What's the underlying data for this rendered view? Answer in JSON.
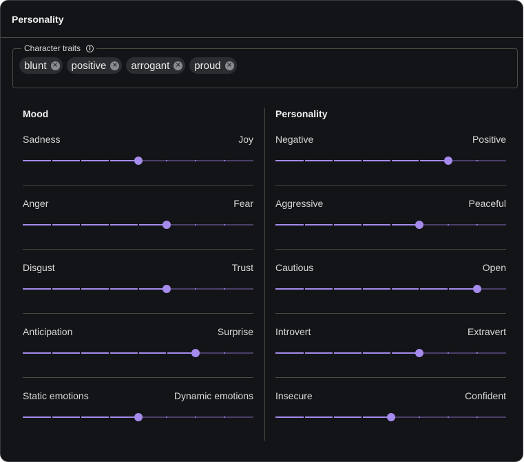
{
  "header": {
    "title": "Personality"
  },
  "traits": {
    "legend": "Character traits",
    "chips": [
      "blunt",
      "positive",
      "arrogant",
      "proud"
    ]
  },
  "mood": {
    "title": "Mood",
    "sliders": [
      {
        "left": "Sadness",
        "right": "Joy",
        "value": 0.5
      },
      {
        "left": "Anger",
        "right": "Fear",
        "value": 0.625
      },
      {
        "left": "Disgust",
        "right": "Trust",
        "value": 0.625
      },
      {
        "left": "Anticipation",
        "right": "Surprise",
        "value": 0.75
      },
      {
        "left": "Static emotions",
        "right": "Dynamic emotions",
        "value": 0.5
      }
    ]
  },
  "personality": {
    "title": "Personality",
    "sliders": [
      {
        "left": "Negative",
        "right": "Positive",
        "value": 0.75
      },
      {
        "left": "Aggressive",
        "right": "Peaceful",
        "value": 0.625
      },
      {
        "left": "Cautious",
        "right": "Open",
        "value": 0.875
      },
      {
        "left": "Introvert",
        "right": "Extravert",
        "value": 0.625
      },
      {
        "left": "Insecure",
        "right": "Confident",
        "value": 0.5
      }
    ]
  },
  "colors": {
    "accent": "#a58bec",
    "track_inactive": "#4a3f6a",
    "background": "#131417",
    "divider": "#4a4b42"
  }
}
